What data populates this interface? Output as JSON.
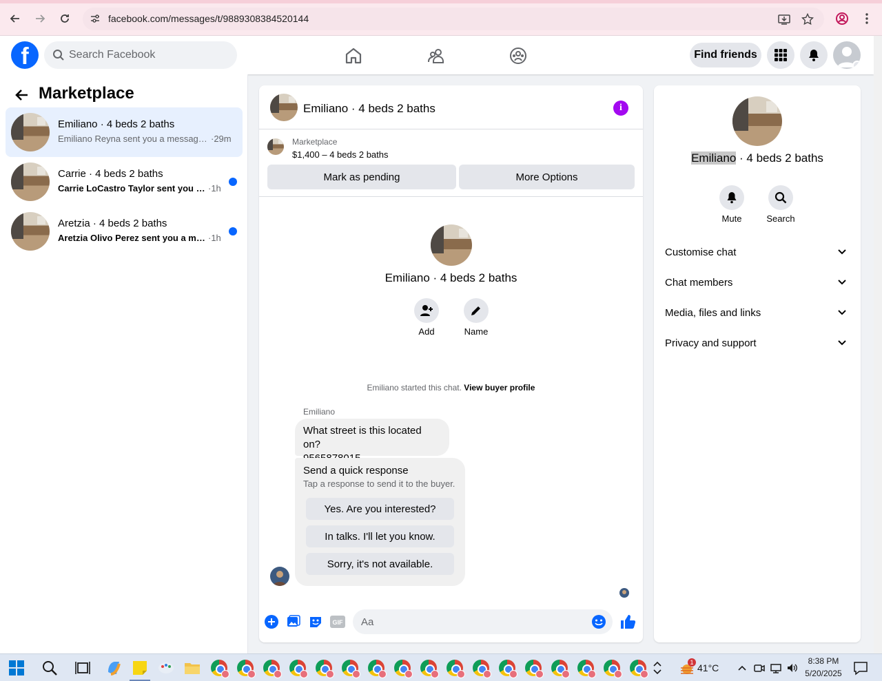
{
  "browser": {
    "url": "facebook.com/messages/t/9889308384520144"
  },
  "header": {
    "logo": "f",
    "search_placeholder": "Search Facebook",
    "find_friends_label": "Find friends"
  },
  "left_pane": {
    "title": "Marketplace",
    "conversations": [
      {
        "name": "Emiliano · 4 beds 2 baths",
        "snippet": "Emiliano Reyna sent you a message ...",
        "time": "·29m",
        "unread": false,
        "active": true
      },
      {
        "name": "Carrie · 4 beds 2 baths",
        "snippet": "Carrie LoCastro Taylor sent you a ...",
        "time": "·1h",
        "unread": true,
        "active": false
      },
      {
        "name": "Aretzia · 4 beds 2 baths",
        "snippet": "Aretzia Olivo Perez sent you a mes...",
        "time": "·1h",
        "unread": true,
        "active": false
      }
    ]
  },
  "chat": {
    "title": "Emiliano · 4 beds 2 baths",
    "info_glyph": "i",
    "listing": {
      "label": "Marketplace",
      "price": "$1,400 – 4 beds 2 baths",
      "mark_pending_label": "Mark as pending",
      "more_options_label": "More Options"
    },
    "intro_name": "Emiliano · 4 beds 2 baths",
    "add_label": "Add",
    "name_label": "Name",
    "started_text": "Emiliano started this chat.",
    "view_buyer_label": "View buyer profile",
    "sender": "Emiliano",
    "message_line1": "What street is this located on?",
    "message_line2": "9565878015",
    "quick_title": "Send a quick response",
    "quick_subtitle": "Tap a response to send it to the buyer.",
    "quick_responses": [
      "Yes. Are you interested?",
      "In talks. I'll let you know.",
      "Sorry, it's not available."
    ],
    "composer_placeholder": "Aa",
    "gif_label": "GIF"
  },
  "right_pane": {
    "name_highlight": "Emiliano",
    "name_rest": " · 4 beds 2 baths",
    "mute_label": "Mute",
    "search_label": "Search",
    "sections": [
      "Customise chat",
      "Chat members",
      "Media, files and links",
      "Privacy and support"
    ]
  },
  "taskbar": {
    "weather_temp": "41°C",
    "weather_badge": "1",
    "time": "8:38 PM",
    "date": "5/20/2025"
  },
  "colors": {
    "fb_blue": "#0866ff",
    "info_purple": "#a309f0",
    "active_bg": "#e7f0fe"
  }
}
